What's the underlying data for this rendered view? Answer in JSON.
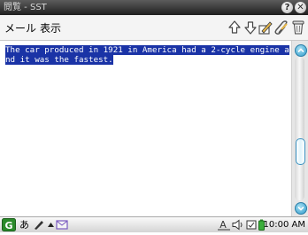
{
  "window": {
    "title": "閲覧 - SST",
    "help_glyph": "?",
    "close_glyph": "✕"
  },
  "menubar": {
    "items": [
      "メール",
      "表示"
    ],
    "tools": [
      "up-arrow-icon",
      "down-arrow-icon",
      "edit-icon",
      "attachment-icon",
      "trash-icon"
    ]
  },
  "message": {
    "body": "The car produced in 1921 in America had a 2-cycle engine and it was the fastest.",
    "selected": true
  },
  "scrollbar": {
    "position": 0.7
  },
  "statusbar": {
    "input_mode": "あ",
    "clock": "10:00 AM"
  },
  "colors": {
    "selection": "#1a33a6",
    "titlebar": "#2a2a2a",
    "scroll_accent": "#2f9ccc"
  }
}
